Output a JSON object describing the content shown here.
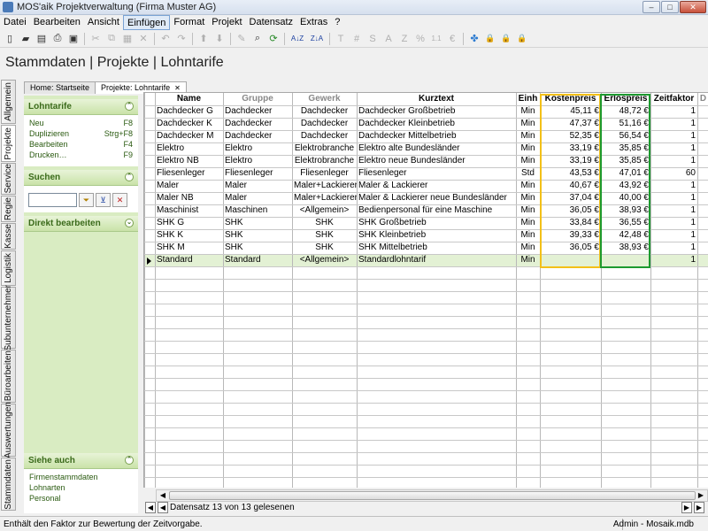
{
  "window": {
    "title": "MOS'aik Projektverwaltung (Firma Muster AG)",
    "minimize": "–",
    "maximize": "□",
    "close": "✕"
  },
  "menu": [
    {
      "label": "Datei"
    },
    {
      "label": "Bearbeiten"
    },
    {
      "label": "Ansicht"
    },
    {
      "label": "Einfügen"
    },
    {
      "label": "Format"
    },
    {
      "label": "Projekt"
    },
    {
      "label": "Datensatz"
    },
    {
      "label": "Extras"
    },
    {
      "label": "?"
    }
  ],
  "toolbar": {
    "new": "▯",
    "open": "▰",
    "save_all": "▤",
    "print": "⎙",
    "preview": "▣",
    "cut": "✂",
    "copy": "⧉",
    "paste": "▦",
    "delete": "✕",
    "undo": "↶",
    "redo": "↷",
    "up": "⬆",
    "down": "⬇",
    "pen": "✎",
    "find": "⌕",
    "refresh": "⟳",
    "sort_asc": "A↓Z",
    "sort_desc": "Z↓A",
    "text": "T",
    "hash": "#",
    "s": "S",
    "a": "A",
    "z": "Z",
    "percent": "%",
    "numbers": "1.1",
    "euro": "€",
    "tool1": "✤",
    "lock1": "🔒",
    "lock2": "🔒",
    "lock3": "🔒"
  },
  "page_title": "Stammdaten | Projekte | Lohntarife",
  "vertical_tabs": [
    {
      "label": "Allgemein"
    },
    {
      "label": "Projekte"
    },
    {
      "label": "Service"
    },
    {
      "label": "Regie"
    },
    {
      "label": "Kasse"
    },
    {
      "label": "Logistik"
    },
    {
      "label": "Subunternehmer"
    },
    {
      "label": "Büroarbeiten"
    },
    {
      "label": "Auswertungen"
    },
    {
      "label": "Stammdaten"
    }
  ],
  "doc_tabs": [
    {
      "label": "Home: Startseite"
    },
    {
      "label": "Projekte: Lohntarife"
    }
  ],
  "sidebar": {
    "lohntarife": {
      "title": "Lohntarife",
      "items": [
        {
          "label": "Neu",
          "shortcut": "F8"
        },
        {
          "label": "Duplizieren",
          "shortcut": "Strg+F8"
        },
        {
          "label": "Bearbeiten",
          "shortcut": "F4"
        },
        {
          "label": "Drucken…",
          "shortcut": "F9"
        }
      ]
    },
    "suchen": {
      "title": "Suchen",
      "value": ""
    },
    "direkt": {
      "title": "Direkt bearbeiten"
    },
    "siehe_auch": {
      "title": "Siehe auch",
      "items": [
        {
          "label": "Firmenstammdaten"
        },
        {
          "label": "Lohnarten"
        },
        {
          "label": "Personal"
        }
      ]
    }
  },
  "table": {
    "columns": [
      "Name",
      "Gruppe",
      "Gewerk",
      "Kurztext",
      "Einh",
      "Kostenpreis",
      "Erlöspreis",
      "Zeitfaktor",
      "D"
    ],
    "rows": [
      [
        "Dachdecker G",
        "Dachdecker",
        "Dachdecker",
        "Dachdecker Großbetrieb",
        "Min",
        "45,11 €",
        "48,72 €",
        "1"
      ],
      [
        "Dachdecker K",
        "Dachdecker",
        "Dachdecker",
        "Dachdecker Kleinbetrieb",
        "Min",
        "47,37 €",
        "51,16 €",
        "1"
      ],
      [
        "Dachdecker M",
        "Dachdecker",
        "Dachdecker",
        "Dachdecker Mittelbetrieb",
        "Min",
        "52,35 €",
        "56,54 €",
        "1"
      ],
      [
        "Elektro",
        "Elektro",
        "Elektrobranche",
        "Elektro alte Bundesländer",
        "Min",
        "33,19 €",
        "35,85 €",
        "1"
      ],
      [
        "Elektro NB",
        "Elektro",
        "Elektrobranche",
        "Elektro neue Bundesländer",
        "Min",
        "33,19 €",
        "35,85 €",
        "1"
      ],
      [
        "Fliesenleger",
        "Fliesenleger",
        "Fliesenleger",
        "Fliesenleger",
        "Std",
        "43,53 €",
        "47,01 €",
        "60"
      ],
      [
        "Maler",
        "Maler",
        "Maler+Lackierer",
        "Maler & Lackierer",
        "Min",
        "40,67 €",
        "43,92 €",
        "1"
      ],
      [
        "Maler NB",
        "Maler",
        "Maler+Lackierer",
        "Maler & Lackierer neue Bundesländer",
        "Min",
        "37,04 €",
        "40,00 €",
        "1"
      ],
      [
        "Maschinist",
        "Maschinen",
        "<Allgemein>",
        "Bedienpersonal für eine Maschine",
        "Min",
        "36,05 €",
        "38,93 €",
        "1"
      ],
      [
        "SHK G",
        "SHK",
        "SHK",
        "SHK Großbetrieb",
        "Min",
        "33,84 €",
        "36,55 €",
        "1"
      ],
      [
        "SHK K",
        "SHK",
        "SHK",
        "SHK Kleinbetrieb",
        "Min",
        "39,33 €",
        "42,48 €",
        "1"
      ],
      [
        "SHK M",
        "SHK",
        "SHK",
        "SHK Mittelbetrieb",
        "Min",
        "36,05 €",
        "38,93 €",
        "1"
      ],
      [
        "Standard",
        "Standard",
        "<Allgemein>",
        "Standardlohntarif",
        "Min",
        "",
        "",
        "1"
      ]
    ]
  },
  "navigator": {
    "first": "◀",
    "prev": "◀",
    "next": "▶",
    "last": "▶",
    "status": "Datensatz 13 von 13 gelesenen"
  },
  "scroll": {
    "left": "◀",
    "right": "▶"
  },
  "statusbar": {
    "hint": "Enthält den Faktor zur Bewertung der Zeitvorgabe.",
    "db": "Admin - Mosaik.mdb"
  }
}
